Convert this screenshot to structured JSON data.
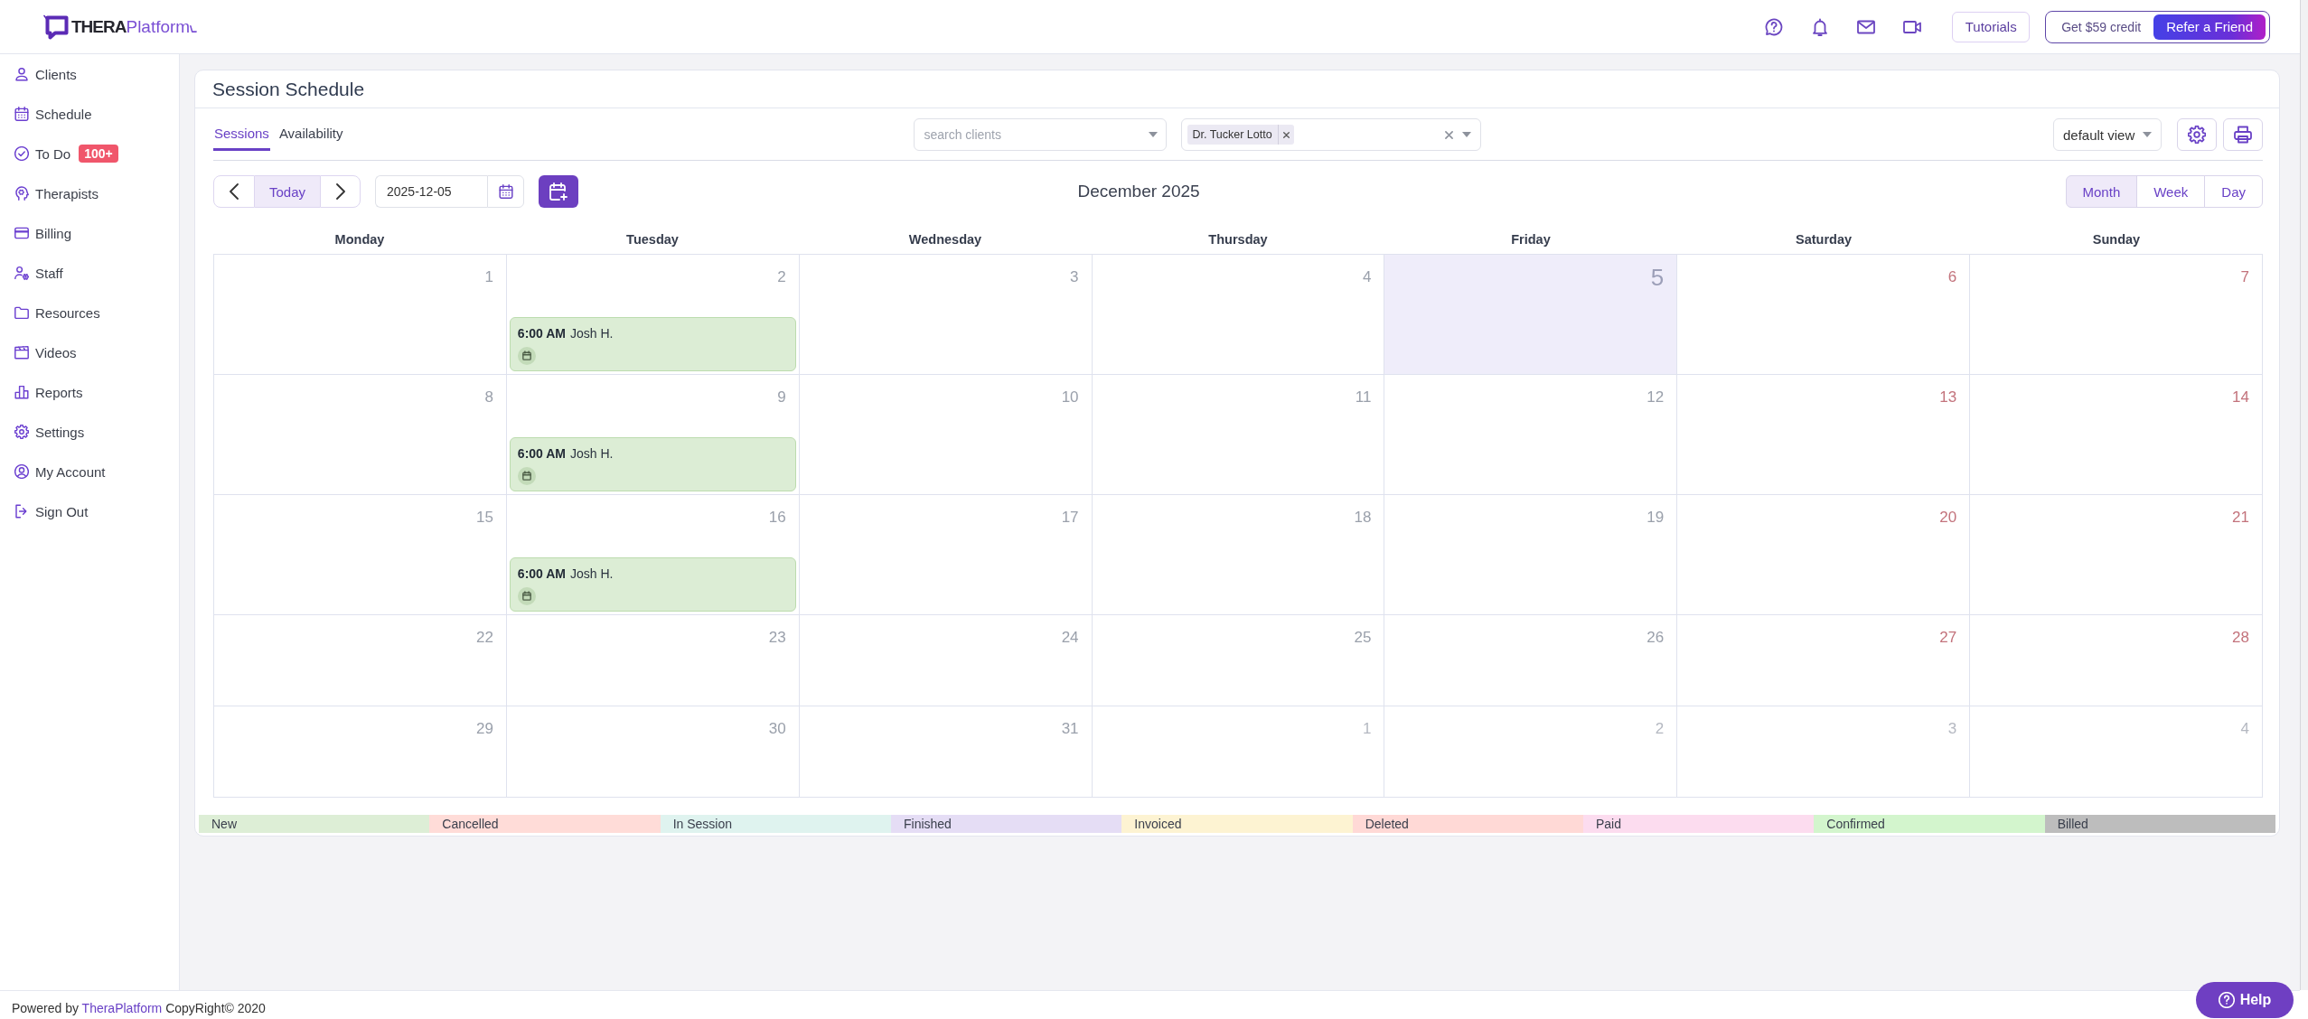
{
  "logo": {
    "bold_part": "THERA",
    "light_part": "Platform"
  },
  "top_bar": {
    "tutorials": "Tutorials",
    "credit_offer": "Get $59 credit",
    "refer_button": "Refer a Friend"
  },
  "sidebar": {
    "items": [
      {
        "label": "Clients"
      },
      {
        "label": "Schedule"
      },
      {
        "label": "To Do",
        "badge": "100+"
      },
      {
        "label": "Therapists"
      },
      {
        "label": "Billing"
      },
      {
        "label": "Staff"
      },
      {
        "label": "Resources"
      },
      {
        "label": "Videos"
      },
      {
        "label": "Reports"
      },
      {
        "label": "Settings"
      },
      {
        "label": "My Account"
      },
      {
        "label": "Sign Out"
      }
    ]
  },
  "page": {
    "title": "Session Schedule",
    "tabs": [
      {
        "label": "Sessions",
        "selected": true
      },
      {
        "label": "Availability",
        "selected": false
      }
    ],
    "client_search": {
      "placeholder": "search clients"
    },
    "therapist_filter": {
      "tags": [
        "Dr. Tucker Lotto"
      ]
    },
    "view_select": {
      "value": "default view"
    }
  },
  "toolbar": {
    "today": "Today",
    "date": {
      "value": "2025-12-05"
    },
    "month_label": "December 2025",
    "views": [
      {
        "label": "Month",
        "selected": true
      },
      {
        "label": "Week",
        "selected": false
      },
      {
        "label": "Day",
        "selected": false
      }
    ]
  },
  "calendar": {
    "weekdays": [
      "Monday",
      "Tuesday",
      "Wednesday",
      "Thursday",
      "Friday",
      "Saturday",
      "Sunday"
    ],
    "weeks": [
      {
        "days": [
          {
            "day": "1",
            "today": false,
            "outside_month": false
          },
          {
            "day": "2",
            "today": false,
            "outside_month": false,
            "events": [
              {
                "time": "6:00 AM",
                "client": "Josh H."
              }
            ]
          },
          {
            "day": "3",
            "today": false,
            "outside_month": false
          },
          {
            "day": "4",
            "today": false,
            "outside_month": false
          },
          {
            "day": "5",
            "today": true,
            "outside_month": false
          },
          {
            "day": "6",
            "today": false,
            "outside_month": false
          },
          {
            "day": "7",
            "today": false,
            "outside_month": false
          }
        ]
      },
      {
        "days": [
          {
            "day": "8",
            "today": false,
            "outside_month": false
          },
          {
            "day": "9",
            "today": false,
            "outside_month": false,
            "events": [
              {
                "time": "6:00 AM",
                "client": "Josh H."
              }
            ]
          },
          {
            "day": "10",
            "today": false,
            "outside_month": false
          },
          {
            "day": "11",
            "today": false,
            "outside_month": false
          },
          {
            "day": "12",
            "today": false,
            "outside_month": false
          },
          {
            "day": "13",
            "today": false,
            "outside_month": false
          },
          {
            "day": "14",
            "today": false,
            "outside_month": false
          }
        ]
      },
      {
        "days": [
          {
            "day": "15",
            "today": false,
            "outside_month": false
          },
          {
            "day": "16",
            "today": false,
            "outside_month": false,
            "events": [
              {
                "time": "6:00 AM",
                "client": "Josh H."
              }
            ]
          },
          {
            "day": "17",
            "today": false,
            "outside_month": false
          },
          {
            "day": "18",
            "today": false,
            "outside_month": false
          },
          {
            "day": "19",
            "today": false,
            "outside_month": false
          },
          {
            "day": "20",
            "today": false,
            "outside_month": false
          },
          {
            "day": "21",
            "today": false,
            "outside_month": false
          }
        ]
      },
      {
        "days": [
          {
            "day": "22",
            "today": false,
            "outside_month": false
          },
          {
            "day": "23",
            "today": false,
            "outside_month": false
          },
          {
            "day": "24",
            "today": false,
            "outside_month": false
          },
          {
            "day": "25",
            "today": false,
            "outside_month": false
          },
          {
            "day": "26",
            "today": false,
            "outside_month": false
          },
          {
            "day": "27",
            "today": false,
            "outside_month": false
          },
          {
            "day": "28",
            "today": false,
            "outside_month": false
          }
        ]
      },
      {
        "days": [
          {
            "day": "29",
            "today": false,
            "outside_month": false
          },
          {
            "day": "30",
            "today": false,
            "outside_month": false
          },
          {
            "day": "31",
            "today": false,
            "outside_month": false
          },
          {
            "day": "1",
            "today": false,
            "outside_month": true
          },
          {
            "day": "2",
            "today": false,
            "outside_month": true
          },
          {
            "day": "3",
            "today": false,
            "outside_month": true
          },
          {
            "day": "4",
            "today": false,
            "outside_month": true
          }
        ]
      }
    ]
  },
  "legend": [
    {
      "label": "New",
      "color": "#ddeed6"
    },
    {
      "label": "Cancelled",
      "color": "#ffdcd8"
    },
    {
      "label": "In Session",
      "color": "#dff3ef"
    },
    {
      "label": "Finished",
      "color": "#e5ddf5"
    },
    {
      "label": "Invoiced",
      "color": "#fdf3d2"
    },
    {
      "label": "Deleted",
      "color": "#ffd9d6"
    },
    {
      "label": "Paid",
      "color": "#fcdcef"
    },
    {
      "label": "Confirmed",
      "color": "#d3f5cd"
    },
    {
      "label": "Billed",
      "color": "#bdbdbd"
    }
  ],
  "footer": {
    "text_before": "Powered by",
    "link": "TheraPlatform",
    "text_after": "CopyRight© 2020"
  },
  "help_button": {
    "label": "Help"
  }
}
